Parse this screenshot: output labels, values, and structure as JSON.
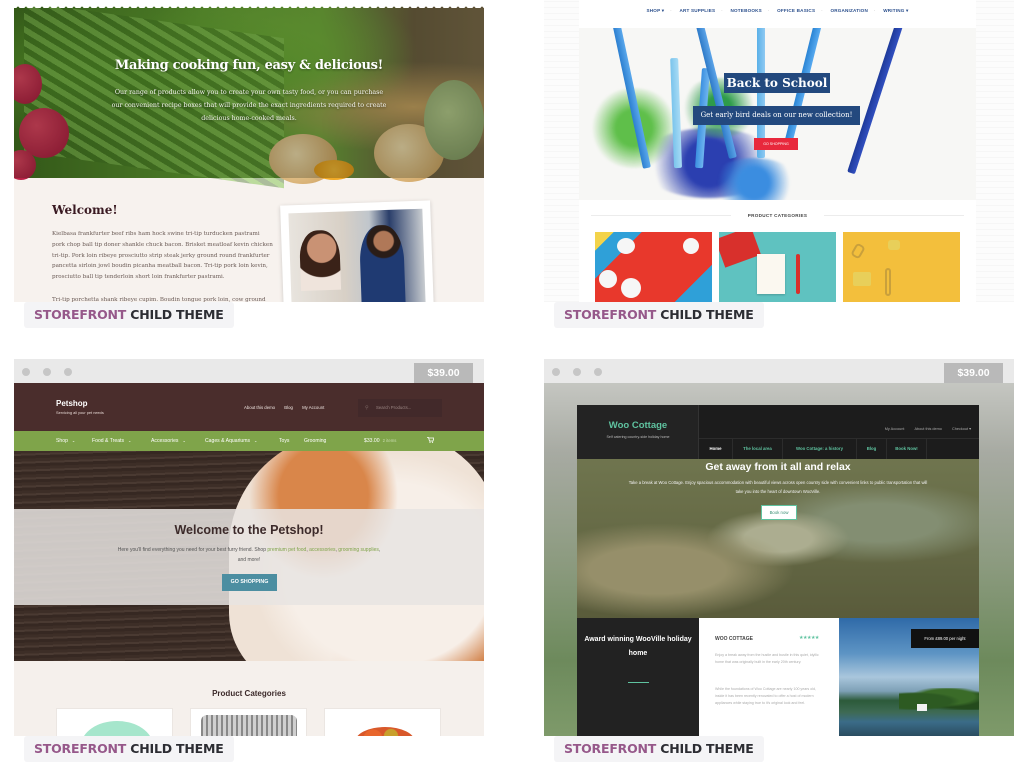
{
  "badge": {
    "brand": "STOREFRONT",
    "label": "CHILD THEME"
  },
  "cards": [
    {
      "name": "cooking",
      "hero": {
        "title": "Making cooking fun, easy & delicious!",
        "text": "Our range of products allow you to create your own tasty food, or you can purchase our convenient recipe boxes that will provide the exact ingredients required to create delicious home-cooked meals."
      },
      "welcome": {
        "title": "Welcome!",
        "paragraph1": "Kielbasa frankfurter beef ribs ham hock swine tri-tip turducken pastrami pork chop ball tip doner shankle chuck bacon. Brisket meatloaf kevin chicken tri-tip. Pork loin ribeye prosciutto strip steak jerky ground round frankfurter pancetta sirloin jowl boudin picanha meatball bacon. Tri-tip pork loin kevin, prosciutto ball tip tenderloin short loin frankfurter pastrami.",
        "paragraph2": "Tri-tip porchetta shank ribeye cupim. Boudin tongue pork loin, cow ground"
      }
    },
    {
      "name": "back-to-school",
      "nav": [
        "SHOP ▾",
        "ART SUPPLIES",
        "NOTEBOOKS",
        "OFFICE BASICS",
        "ORGANIZATION",
        "WRITING ▾"
      ],
      "hero": {
        "title": "Back to School",
        "subtitle": "Get early bird deals on our new collection!",
        "button": "GO SHOPPING"
      },
      "categories_title": "PRODUCT CATEGORIES"
    },
    {
      "name": "petshop",
      "price": "$39.00",
      "brand": "Petshop",
      "tagline": "Servicing all your pet needs",
      "top_links": [
        "About this demo",
        "Blog",
        "My Account"
      ],
      "search_placeholder": "Search Products...",
      "nav": [
        "Shop",
        "Food & Treats",
        "Accessories",
        "Cages & Aquariums",
        "Toys",
        "Grooming"
      ],
      "cart_amount": "$33.00",
      "cart_count": "2 items",
      "hero": {
        "title": "Welcome to the Petshop!",
        "text_before": "Here you'll find everything you need for your best furry friend. Shop ",
        "link1": "premium pet food",
        "sep1": ", ",
        "link2": "accessories",
        "sep2": ", ",
        "link3": "grooming supplies",
        "text_after": ", and more!",
        "button": "GO SHOPPING"
      },
      "categories_title": "Product Categories"
    },
    {
      "name": "woo-cottage",
      "price": "$39.00",
      "brand": "Woo Cottage",
      "tagline": "Self catering country-side holiday home",
      "top_links": [
        "My Account",
        "About this demo",
        "Checkout ▾"
      ],
      "nav": [
        "Home",
        "The local area",
        "Woo Cottage: a history",
        "Blog",
        "Book Now!"
      ],
      "hero": {
        "title": "Get away from it all and relax",
        "text": "Take a break at Woo Cottage. Enjoy spacious accommodation with beautiful views across open country side with convenient links to public transportation that will take you into the heart of downtown WooVille.",
        "button": "Book now"
      },
      "award": "Award winning WooVille holiday home",
      "info": {
        "title": "WOO COTTAGE",
        "stars": "★★★★★",
        "paragraph1": "Enjoy a break away from the hustle and bustle in this quiet, idyllic home that was originally built in the early 20th century.",
        "paragraph2": "While the foundations of Woo Cottage are nearly 100 years old, inside it has been recently renovated to offer a host of modern appliances while staying true to it's original look and feel."
      },
      "price_tag": "From £89.00 per night"
    }
  ]
}
